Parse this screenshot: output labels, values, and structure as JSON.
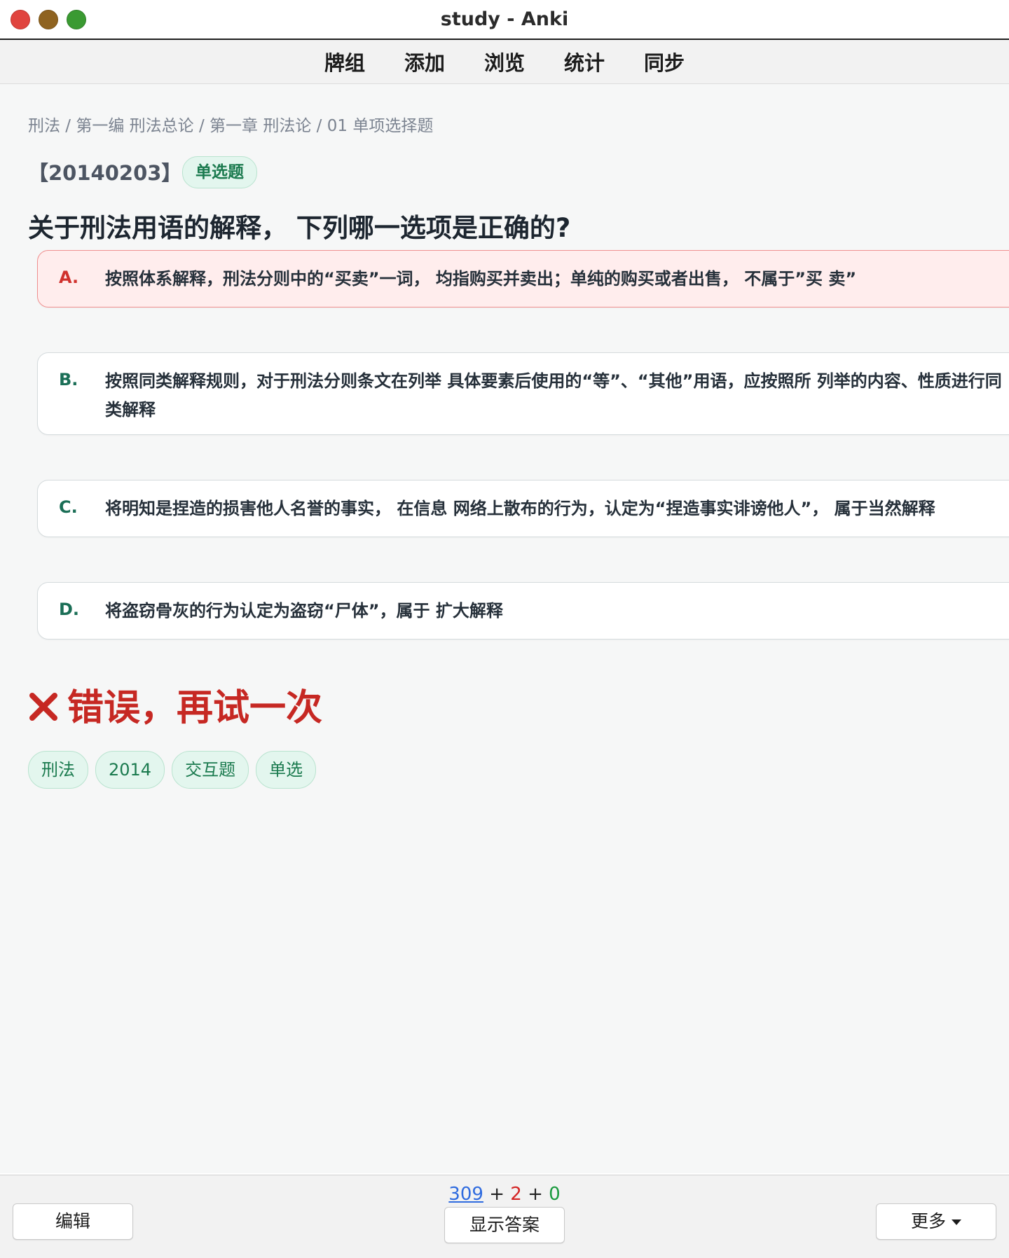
{
  "window": {
    "title": "study - Anki"
  },
  "toolbar": {
    "items": [
      {
        "label": "牌组"
      },
      {
        "label": "添加"
      },
      {
        "label": "浏览"
      },
      {
        "label": "统计"
      },
      {
        "label": "同步"
      }
    ]
  },
  "card": {
    "breadcrumb": "刑法 / 第一编 刑法总论 / 第一章 刑法论 / 01 单项选择题",
    "question_id": "【20140203】",
    "question_type": "单选题",
    "question": "关于刑法用语的解释， 下列哪一选项是正确的?",
    "options": [
      {
        "letter": "A.",
        "text": "按照体系解释，刑法分则中的“买卖”一词， 均指购买并卖出；单纯的购买或者出售， 不属于”买 卖”",
        "state": "wrong"
      },
      {
        "letter": "B.",
        "text": "按照同类解释规则，对于刑法分则条文在列举 具体要素后使用的“等”、“其他”用语，应按照所 列举的内容、性质进行同类解释",
        "state": "normal"
      },
      {
        "letter": "C.",
        "text": "将明知是捏造的损害他人名誉的事实， 在信息 网络上散布的行为，认定为“捏造事实诽谤他人”， 属于当然解释",
        "state": "normal"
      },
      {
        "letter": "D.",
        "text": "将盗窃骨灰的行为认定为盗窃“尸体”，属于 扩大解释",
        "state": "normal"
      }
    ],
    "feedback": "错误，再试一次",
    "feedback_color": "#c62823",
    "tags": [
      "刑法",
      "2014",
      "交互题",
      "单选"
    ]
  },
  "bottombar": {
    "counts": {
      "new": "309",
      "plus1": "+",
      "learn": "2",
      "plus2": "+",
      "review": "0"
    },
    "edit_label": "编辑",
    "show_answer_label": "显示答案",
    "more_label": "更多"
  }
}
